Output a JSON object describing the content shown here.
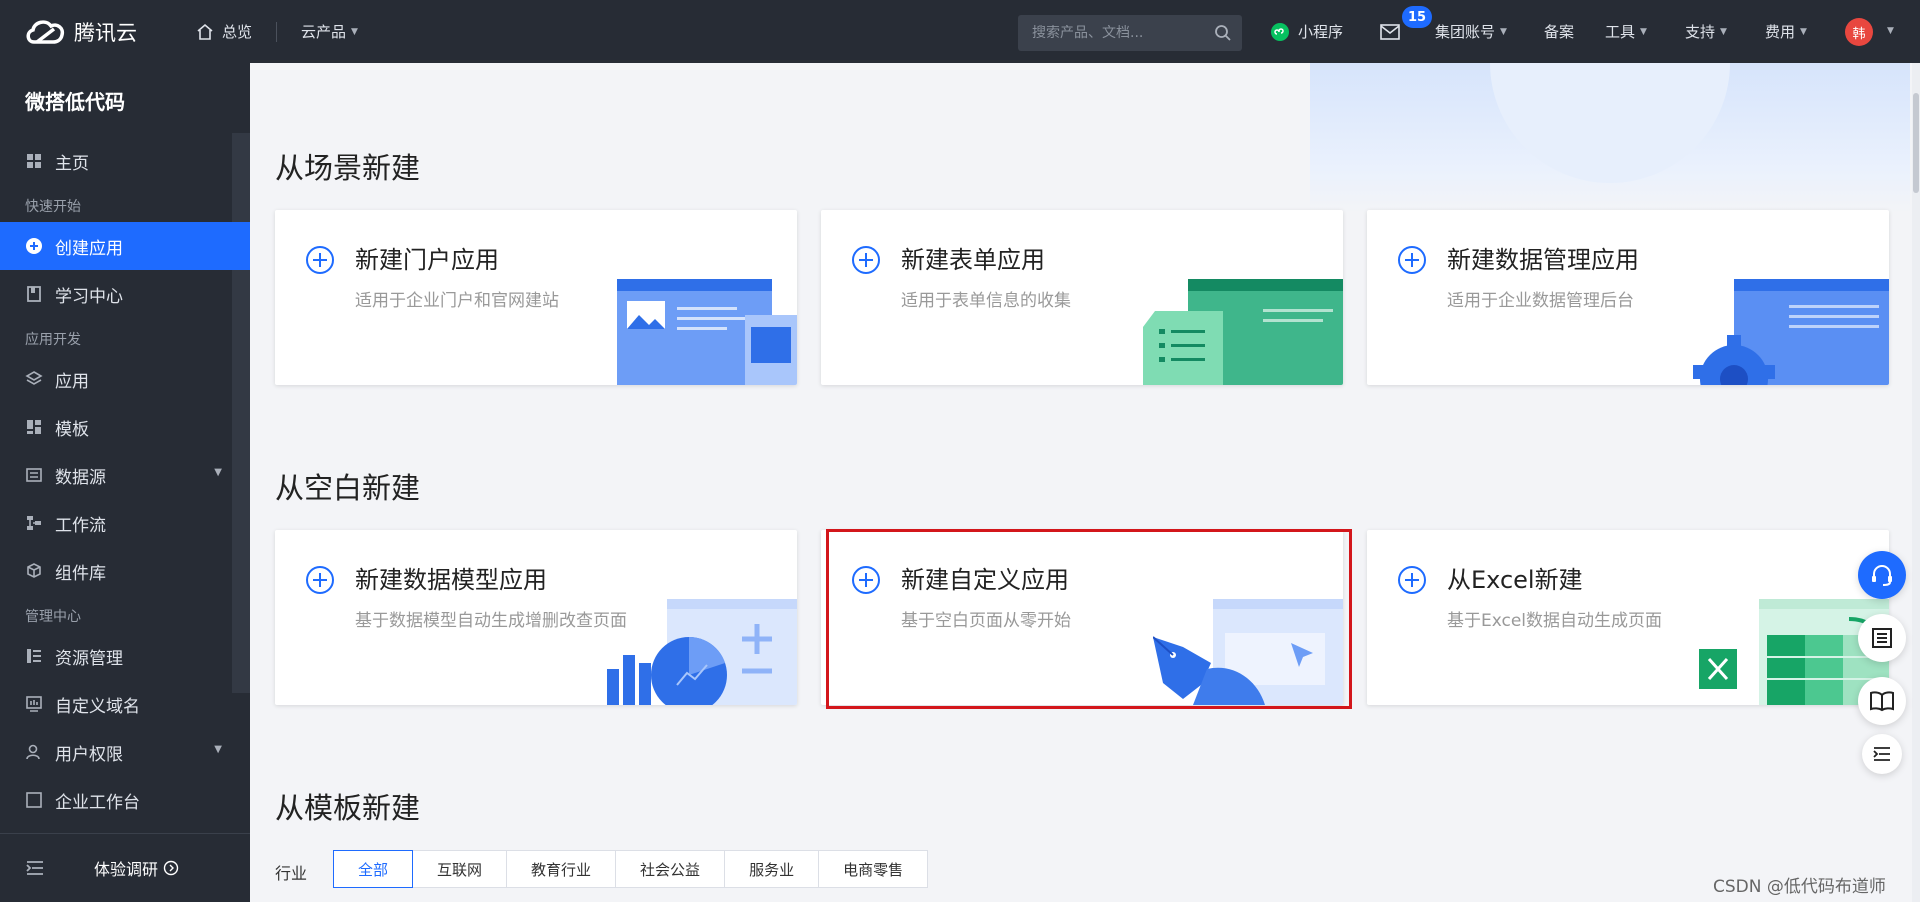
{
  "topbar": {
    "brand": "腾讯云",
    "home": "总览",
    "products": "云产品",
    "search_placeholder": "搜索产品、文档...",
    "mini_program": "小程序",
    "notification_count": "15",
    "group_account": "集团账号",
    "beian": "备案",
    "tools": "工具",
    "support": "支持",
    "fees": "费用",
    "avatar_text": "韩"
  },
  "sidebar": {
    "title": "微搭低代码",
    "home": "主页",
    "group_quick": "快速开始",
    "create_app": "创建应用",
    "learn": "学习中心",
    "group_dev": "应用开发",
    "apps": "应用",
    "templates": "模板",
    "datasource": "数据源",
    "workflow": "工作流",
    "components": "组件库",
    "group_manage": "管理中心",
    "resources": "资源管理",
    "domains": "自定义域名",
    "permissions": "用户权限",
    "workbench": "企业工作台",
    "feedback": "体验调研"
  },
  "sections": {
    "scene": "从场景新建",
    "blank": "从空白新建",
    "template": "从模板新建"
  },
  "cards": {
    "portal": {
      "title": "新建门户应用",
      "desc": "适用于企业门户和官网建站"
    },
    "form": {
      "title": "新建表单应用",
      "desc": "适用于表单信息的收集"
    },
    "data": {
      "title": "新建数据管理应用",
      "desc": "适用于企业数据管理后台"
    },
    "model": {
      "title": "新建数据模型应用",
      "desc": "基于数据模型自动生成增删改查页面"
    },
    "custom": {
      "title": "新建自定义应用",
      "desc": "基于空白页面从零开始"
    },
    "excel": {
      "title": "从Excel新建",
      "desc": "基于Excel数据自动生成页面"
    }
  },
  "filter": {
    "label": "行业",
    "options": [
      "全部",
      "互联网",
      "教育行业",
      "社会公益",
      "服务业",
      "电商零售"
    ]
  },
  "watermark": "CSDN @低代码布道师",
  "colors": {
    "accent": "#1e6bff",
    "topbar": "#272c35",
    "highlight": "#d3161b"
  }
}
